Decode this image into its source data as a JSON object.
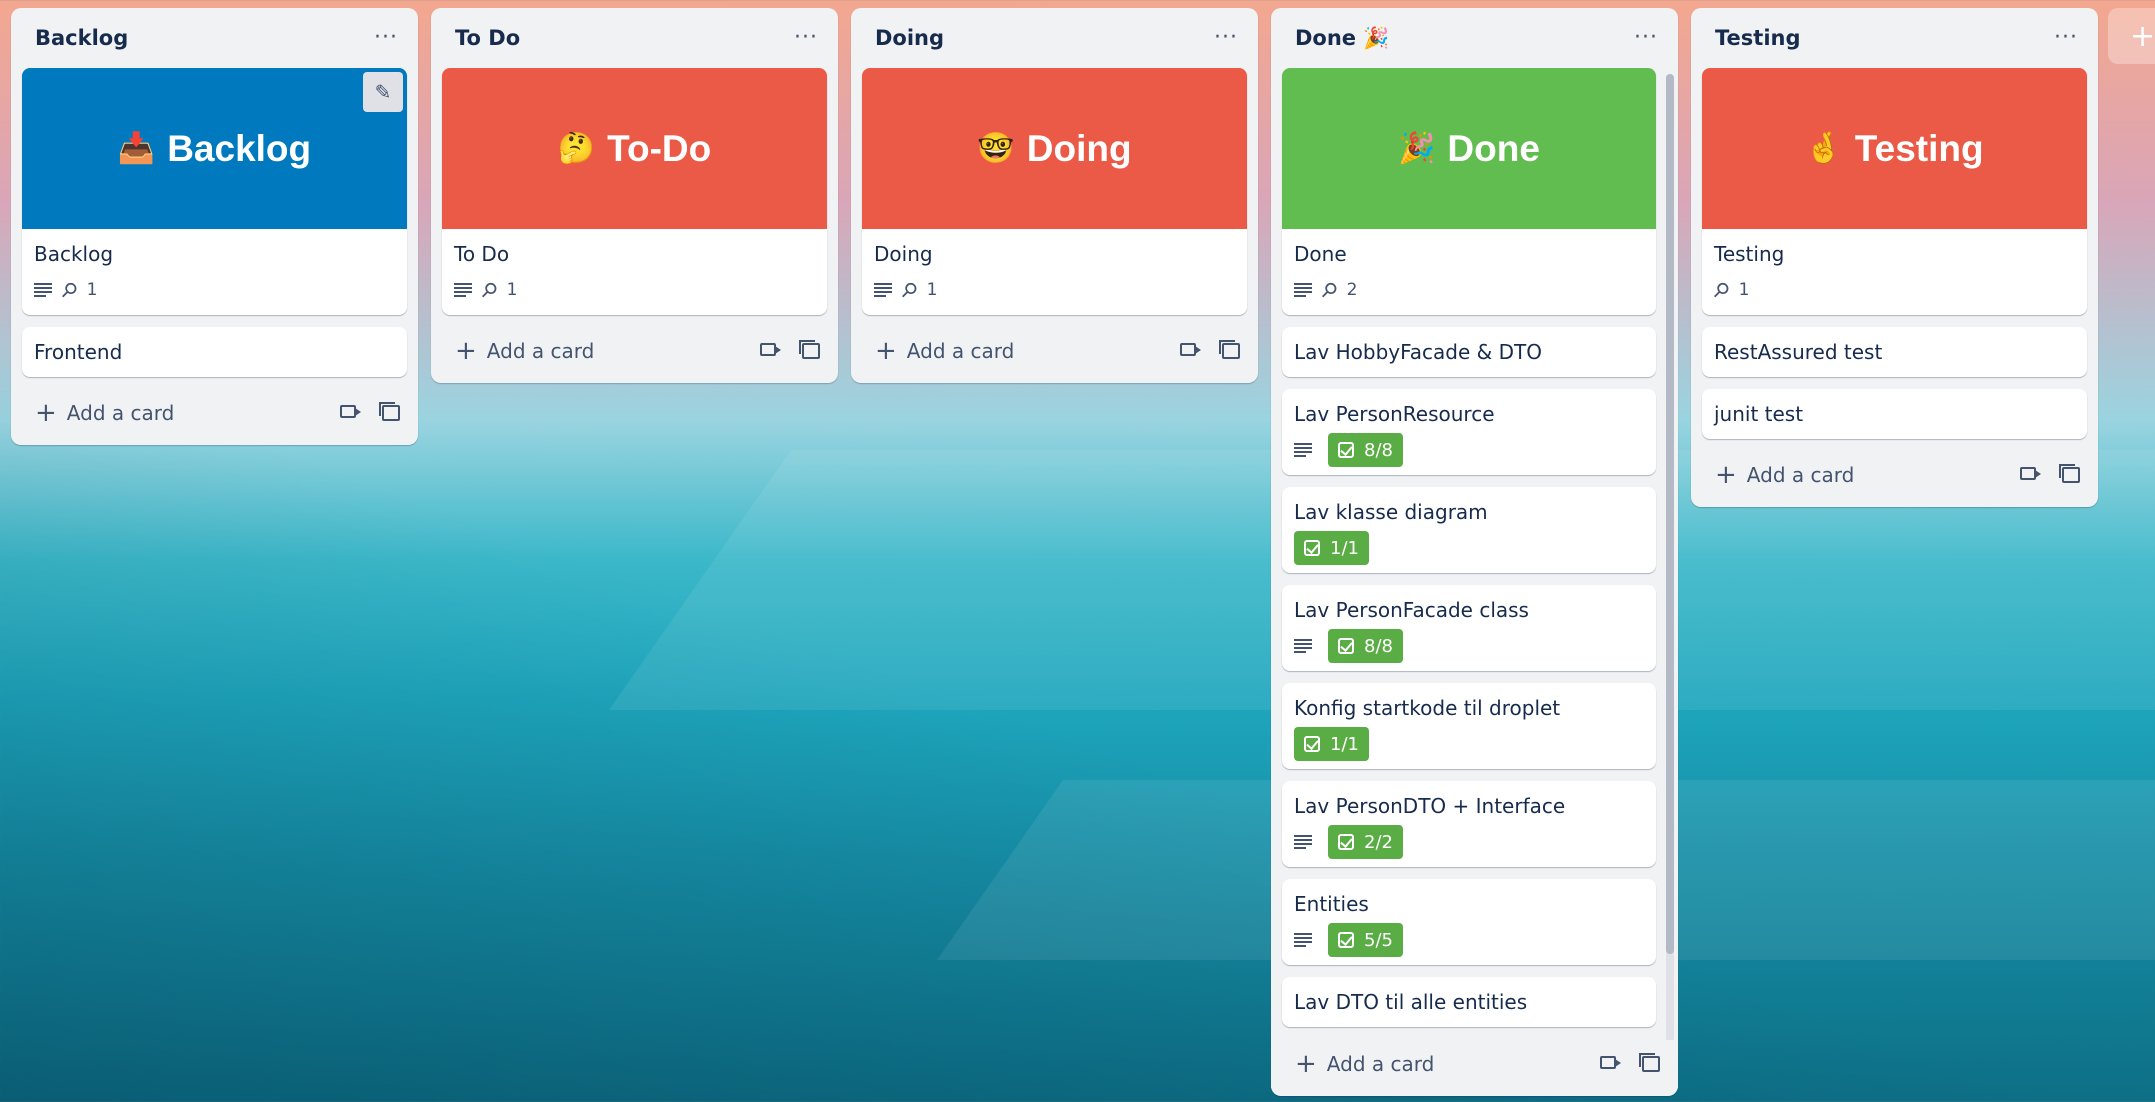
{
  "board": {
    "lists": [
      {
        "title": "Backlog",
        "cover_card": {
          "emoji": "📥",
          "cover_text": "Backlog",
          "cover_color": "#0079bf",
          "title": "Backlog",
          "attachments": "1"
        },
        "cards": [
          {
            "title": "Frontend"
          }
        ],
        "add_card": "Add a card"
      },
      {
        "title": "To Do",
        "cover_card": {
          "emoji": "🤔",
          "cover_text": "To-Do",
          "cover_color": "#eb5a46",
          "title": "To Do",
          "attachments": "1"
        },
        "cards": [],
        "add_card": "Add a card"
      },
      {
        "title": "Doing",
        "cover_card": {
          "emoji": "🤓",
          "cover_text": "Doing",
          "cover_color": "#eb5a46",
          "title": "Doing",
          "attachments": "1"
        },
        "cards": [],
        "add_card": "Add a card"
      },
      {
        "title": "Done 🎉",
        "cover_card": {
          "emoji": "🎉",
          "cover_text": "Done",
          "cover_color": "#61bd4f",
          "title": "Done",
          "attachments": "2"
        },
        "cards": [
          {
            "title": "Lav HobbyFacade & DTO"
          },
          {
            "title": "Lav PersonResource",
            "checklist": "8/8"
          },
          {
            "title": "Lav klasse diagram",
            "checklist": "1/1"
          },
          {
            "title": "Lav PersonFacade class",
            "checklist": "8/8"
          },
          {
            "title": "Konfig startkode til droplet",
            "checklist": "1/1"
          },
          {
            "title": "Lav PersonDTO + Interface",
            "checklist": "2/2"
          },
          {
            "title": "Entities",
            "checklist": "5/5"
          },
          {
            "title": "Lav DTO til alle entities"
          }
        ],
        "add_card": "Add a card"
      },
      {
        "title": "Testing",
        "cover_card": {
          "emoji": "🤞",
          "cover_text": "Testing",
          "cover_color": "#eb5a46",
          "title": "Testing",
          "attachments": "1"
        },
        "cards": [
          {
            "title": "RestAssured test"
          },
          {
            "title": "junit test"
          }
        ],
        "add_card": "Add a card"
      }
    ],
    "add_list_icon": "+"
  },
  "colors": {
    "list_bg": "#f1f2f4",
    "checklist_done": "#5aac44",
    "text": "#172b4d"
  }
}
